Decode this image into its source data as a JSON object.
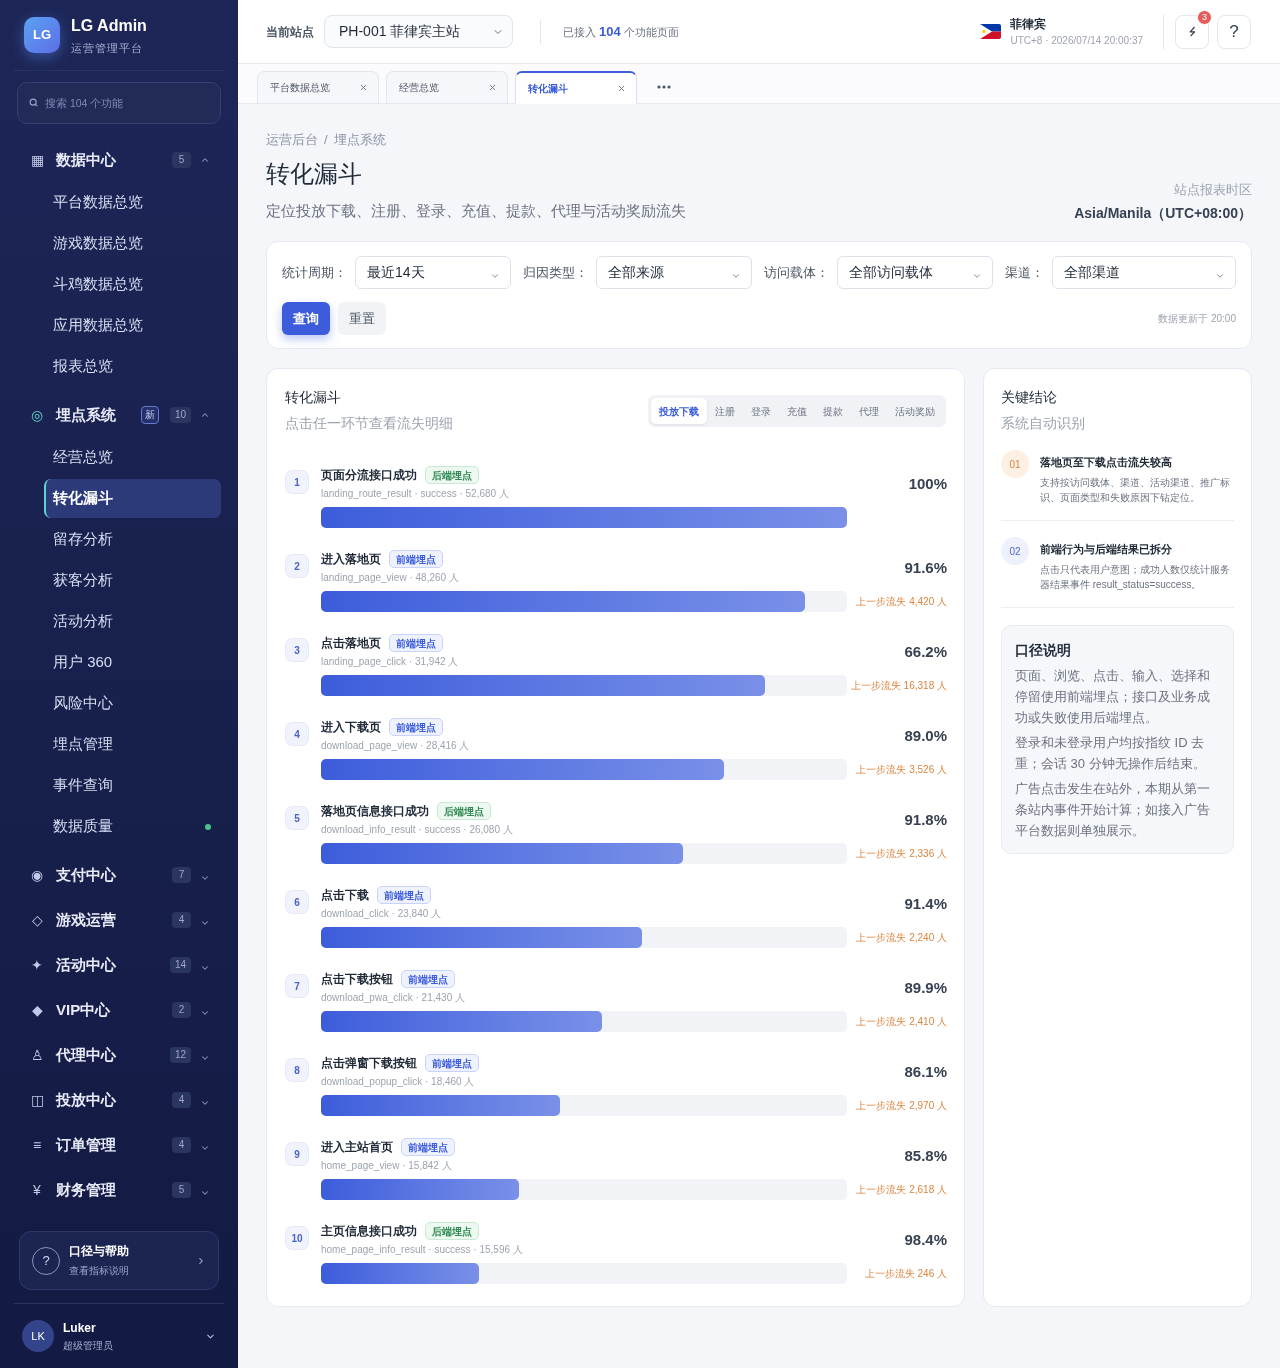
{
  "sidebar": {
    "brand": {
      "logo": "LG",
      "name": "LG Admin",
      "subtitle": "运营管理平台"
    },
    "search": {
      "placeholder": "搜索 104 个功能"
    },
    "groups": [
      {
        "icon": "▦",
        "label": "数据中心",
        "count": "5",
        "expanded": true,
        "children": [
          {
            "label": "平台数据总览",
            "selected": false
          },
          {
            "label": "游戏数据总览",
            "selected": false
          },
          {
            "label": "斗鸡数据总览",
            "selected": false
          },
          {
            "label": "应用数据总览",
            "selected": false
          },
          {
            "label": "报表总览",
            "selected": false
          }
        ]
      },
      {
        "icon": "◎",
        "label": "埋点系统",
        "badge": "新",
        "count": "10",
        "expanded": true,
        "children": [
          {
            "label": "经营总览",
            "selected": false
          },
          {
            "label": "转化漏斗",
            "selected": true
          },
          {
            "label": "留存分析",
            "selected": false
          },
          {
            "label": "获客分析",
            "selected": false
          },
          {
            "label": "活动分析",
            "selected": false
          },
          {
            "label": "用户 360",
            "selected": false
          },
          {
            "label": "风险中心",
            "selected": false
          },
          {
            "label": "埋点管理",
            "selected": false
          },
          {
            "label": "事件查询",
            "selected": false
          },
          {
            "label": "数据质量",
            "selected": false,
            "color": "#4cc38a"
          }
        ]
      },
      {
        "icon": "◉",
        "label": "支付中心",
        "count": "7",
        "expanded": false
      },
      {
        "icon": "◇",
        "label": "游戏运营",
        "count": "4",
        "expanded": false
      },
      {
        "icon": "✦",
        "label": "活动中心",
        "count": "14",
        "expanded": false
      },
      {
        "icon": "◆",
        "label": "VIP中心",
        "count": "2",
        "expanded": false
      },
      {
        "icon": "♙",
        "label": "代理中心",
        "count": "12",
        "expanded": false
      },
      {
        "icon": "◫",
        "label": "投放中心",
        "count": "4",
        "expanded": false
      },
      {
        "icon": "≡",
        "label": "订单管理",
        "count": "4",
        "expanded": false
      },
      {
        "icon": "¥",
        "label": "财务管理",
        "count": "5",
        "expanded": false
      }
    ],
    "help": {
      "icon": "?",
      "title": "口径与帮助",
      "subtitle": "查看指标说明"
    },
    "user": {
      "initials": "LK",
      "name": "Luker",
      "role": "超级管理员"
    }
  },
  "header": {
    "site_label": "当前站点",
    "site_select": {
      "value": "PH-001 菲律宾主站"
    },
    "connected": "已接入 **104** 个功能页面",
    "region": {
      "name": "菲律宾",
      "time": "UTC+8 · 2026/07/14 20:00:37"
    },
    "notifications": {
      "count": "3"
    },
    "help_button": {
      "label": "?"
    }
  },
  "tabs": [
    {
      "label": "平台数据总览",
      "selected": false
    },
    {
      "label": "经营总览",
      "selected": false
    },
    {
      "label": "转化漏斗",
      "selected": true
    }
  ],
  "page": {
    "breadcrumb": [
      "运营后台",
      "埋点系统"
    ],
    "breadcrumb_separator": "/",
    "title": "转化漏斗",
    "subtitle": "定位投放下载、注册、登录、充值、提款、代理与活动奖励流失",
    "timezone": {
      "label": "站点报表时区",
      "value": "Asia/Manila（UTC+08:00）"
    }
  },
  "filters": {
    "fields": [
      {
        "label": "统计周期：",
        "value": "最近14天"
      },
      {
        "label": "归因类型：",
        "value": "全部来源"
      },
      {
        "label": "访问载体：",
        "value": "全部访问载体"
      },
      {
        "label": "渠道：",
        "value": "全部渠道"
      }
    ],
    "buttons": [
      {
        "label": "查询",
        "kind": "primary"
      },
      {
        "label": "重置",
        "kind": "secondary"
      }
    ],
    "updated": "数据更新于 20:00"
  },
  "funnel": {
    "title": "转化漏斗",
    "subtitle": "点击任一环节查看流失明细",
    "stages": [
      {
        "label": "投放下载",
        "selected": true
      },
      {
        "label": "注册",
        "selected": false
      },
      {
        "label": "登录",
        "selected": false
      },
      {
        "label": "充值",
        "selected": false
      },
      {
        "label": "提款",
        "selected": false
      },
      {
        "label": "代理",
        "selected": false
      },
      {
        "label": "活动奖励",
        "selected": false
      }
    ],
    "steps": [
      {
        "index": "1",
        "name": "页面分流接口成功",
        "tag": {
          "label": "后端埋点",
          "kind": "backend"
        },
        "meta": "landing_route_result · success · 52,680 人",
        "rate": "100%",
        "level": 1
      },
      {
        "index": "2",
        "name": "进入落地页",
        "tag": {
          "label": "前端埋点",
          "kind": "frontend"
        },
        "meta": "landing_page_view · 48,260 人",
        "rate": "91.6%",
        "level": 0.921,
        "drop": "上一步流失 4,420 人"
      },
      {
        "index": "3",
        "name": "点击落地页",
        "tag": {
          "label": "前端埋点",
          "kind": "frontend"
        },
        "meta": "landing_page_click · 31,942 人",
        "rate": "66.2%",
        "level": 0.845,
        "drop": "上一步流失 16,318 人"
      },
      {
        "index": "4",
        "name": "进入下载页",
        "tag": {
          "label": "前端埋点",
          "kind": "frontend"
        },
        "meta": "download_page_view · 28,416 人",
        "rate": "89.0%",
        "level": 0.766,
        "drop": "上一步流失 3,526 人"
      },
      {
        "index": "5",
        "name": "落地页信息接口成功",
        "tag": {
          "label": "后端埋点",
          "kind": "backend"
        },
        "meta": "download_info_result · success · 26,080 人",
        "rate": "91.8%",
        "level": 0.689,
        "drop": "上一步流失 2,336 人"
      },
      {
        "index": "6",
        "name": "点击下载",
        "tag": {
          "label": "前端埋点",
          "kind": "frontend"
        },
        "meta": "download_click · 23,840 人",
        "rate": "91.4%",
        "level": 0.611,
        "drop": "上一步流失 2,240 人"
      },
      {
        "index": "7",
        "name": "点击下载按钮",
        "tag": {
          "label": "前端埋点",
          "kind": "frontend"
        },
        "meta": "download_pwa_click · 21,430 人",
        "rate": "89.9%",
        "level": 0.534,
        "drop": "上一步流失 2,410 人"
      },
      {
        "index": "8",
        "name": "点击弹窗下载按钮",
        "tag": {
          "label": "前端埋点",
          "kind": "frontend"
        },
        "meta": "download_popup_click · 18,460 人",
        "rate": "86.1%",
        "level": 0.455,
        "drop": "上一步流失 2,970 人"
      },
      {
        "index": "9",
        "name": "进入主站首页",
        "tag": {
          "label": "前端埋点",
          "kind": "frontend"
        },
        "meta": "home_page_view · 15,842 人",
        "rate": "85.8%",
        "level": 0.376,
        "drop": "上一步流失 2,618 人"
      },
      {
        "index": "10",
        "name": "主页信息接口成功",
        "tag": {
          "label": "后端埋点",
          "kind": "backend"
        },
        "meta": "home_page_info_result · success · 15,596 人",
        "rate": "98.4%",
        "level": 0.3,
        "drop": "上一步流失 246 人"
      }
    ]
  },
  "insights": {
    "title": "关键结论",
    "subtitle": "系统自动识别",
    "items": [
      {
        "number": "01",
        "kind": "warning",
        "title": "落地页至下载点击流失较高",
        "body": "支持按访问载体、渠道、活动渠道、推广标识、页面类型和失败原因下钻定位。"
      },
      {
        "number": "02",
        "kind": "info",
        "title": "前端行为与后端结果已拆分",
        "body": "点击只代表用户意图；成功人数仅统计服务器结果事件 result_status=success。"
      }
    ],
    "note": {
      "title": "口径说明",
      "paragraphs": [
        "页面、浏览、点击、输入、选择和停留使用前端埋点；接口及业务成功或失败使用后端埋点。",
        "登录和未登录用户均按指纹 ID 去重；会话 30 分钟无操作后结束。",
        "广告点击发生在站外，本期从第一条站内事件开始计算；如接入广告平台数据则单独展示。"
      ]
    }
  }
}
